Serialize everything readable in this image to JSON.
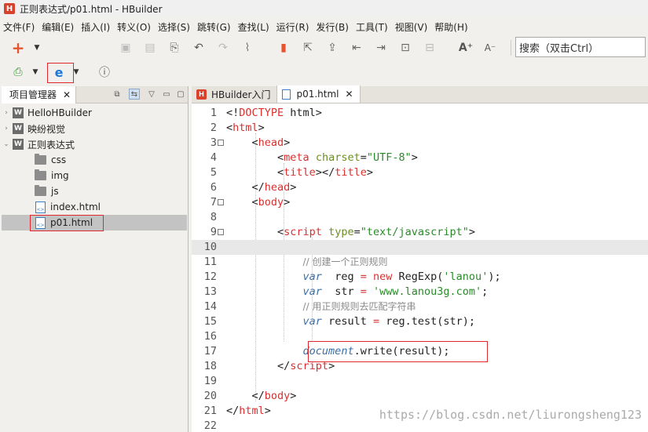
{
  "window": {
    "title": "正则表达式/p01.html  -  HBuilder",
    "app_icon": "H"
  },
  "menu": [
    "文件(F)",
    "编辑(E)",
    "插入(I)",
    "转义(O)",
    "选择(S)",
    "跳转(G)",
    "查找(L)",
    "运行(R)",
    "发行(B)",
    "工具(T)",
    "视图(V)",
    "帮助(H)"
  ],
  "search": {
    "placeholder": "搜索（双击Ctrl）"
  },
  "project_panel": {
    "tab_label": "项目管理器",
    "items": [
      {
        "label": "HelloHBuilder",
        "type": "project",
        "expanded": false
      },
      {
        "label": "映纷视觉",
        "type": "project",
        "expanded": false
      },
      {
        "label": "正则表达式",
        "type": "project",
        "expanded": true
      },
      {
        "label": "css",
        "type": "folder"
      },
      {
        "label": "img",
        "type": "folder"
      },
      {
        "label": "js",
        "type": "folder"
      },
      {
        "label": "index.html",
        "type": "file"
      },
      {
        "label": "p01.html",
        "type": "file",
        "selected": true
      }
    ]
  },
  "editor": {
    "tabs": [
      {
        "label": "HBuilder入门",
        "active": false
      },
      {
        "label": "p01.html",
        "active": true
      }
    ],
    "current_line": 10,
    "line_numbers": [
      "1",
      "2",
      "3",
      "4",
      "5",
      "6",
      "7",
      "8",
      "9",
      "10",
      "11",
      "12",
      "13",
      "14",
      "15",
      "16",
      "17",
      "18",
      "19",
      "20",
      "21",
      "22"
    ]
  },
  "watermark": "https://blog.csdn.net/liurongsheng123",
  "colors": {
    "highlight_box": "#e0282e",
    "tag": "#d93030",
    "string": "#2a8a2a",
    "keyword": "#3a6ea5"
  }
}
